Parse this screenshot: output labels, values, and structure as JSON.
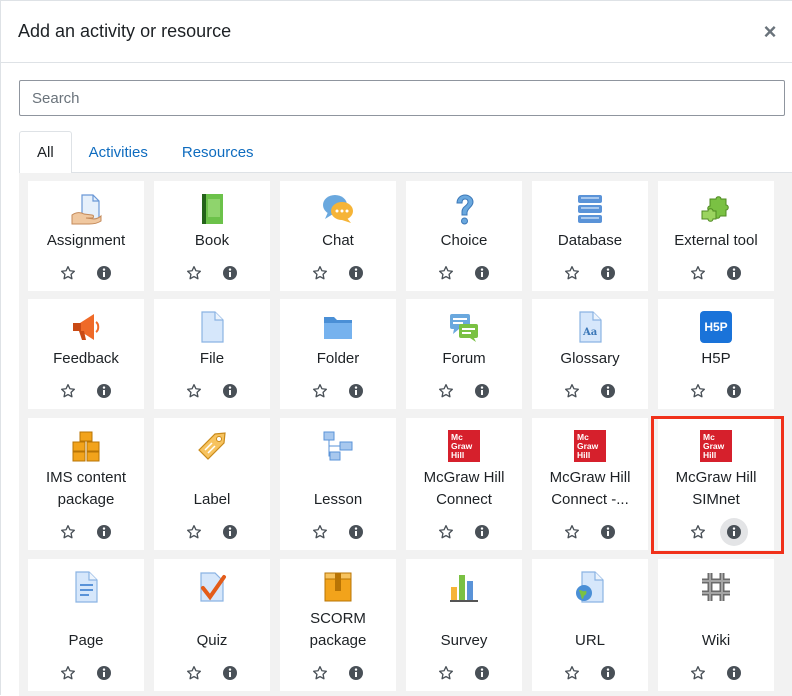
{
  "dialog": {
    "title": "Add an activity or resource",
    "close_glyph": "×",
    "close_icon": "close-icon"
  },
  "search": {
    "placeholder": "Search",
    "value": ""
  },
  "tabs": [
    {
      "label": "All",
      "active": true
    },
    {
      "label": "Activities",
      "active": false
    },
    {
      "label": "Resources",
      "active": false
    }
  ],
  "colors": {
    "link": "#0f6cbf",
    "grid_bg": "#f2f2f2",
    "highlight": "#f0311a",
    "mcgraw_red": "#d6202c"
  },
  "items": [
    {
      "name": "Assignment",
      "icon": "assignment-icon"
    },
    {
      "name": "Book",
      "icon": "book-icon"
    },
    {
      "name": "Chat",
      "icon": "chat-icon"
    },
    {
      "name": "Choice",
      "icon": "choice-icon"
    },
    {
      "name": "Database",
      "icon": "database-icon"
    },
    {
      "name": "External tool",
      "icon": "external-tool-icon"
    },
    {
      "name": "Feedback",
      "icon": "feedback-icon"
    },
    {
      "name": "File",
      "icon": "file-icon"
    },
    {
      "name": "Folder",
      "icon": "folder-icon"
    },
    {
      "name": "Forum",
      "icon": "forum-icon"
    },
    {
      "name": "Glossary",
      "icon": "glossary-icon"
    },
    {
      "name": "H5P",
      "icon": "h5p-icon",
      "logo_text": "H5P"
    },
    {
      "name": "IMS content package",
      "lines": [
        "IMS content",
        "package"
      ],
      "icon": "ims-package-icon"
    },
    {
      "name": "Label",
      "icon": "label-icon"
    },
    {
      "name": "Lesson",
      "icon": "lesson-icon"
    },
    {
      "name": "McGraw Hill Connect",
      "lines": [
        "McGraw Hill",
        "Connect"
      ],
      "icon": "mcgraw-hill-icon",
      "logo_lines": [
        "Mc",
        "Graw",
        "Hill"
      ]
    },
    {
      "name": "McGraw Hill Connect -...",
      "lines": [
        "McGraw Hill",
        "Connect -..."
      ],
      "icon": "mcgraw-hill-icon",
      "logo_lines": [
        "Mc",
        "Graw",
        "Hill"
      ]
    },
    {
      "name": "McGraw Hill SIMnet",
      "lines": [
        "McGraw Hill",
        "SIMnet"
      ],
      "icon": "mcgraw-hill-icon",
      "logo_lines": [
        "Mc",
        "Graw",
        "Hill"
      ],
      "highlighted": true
    },
    {
      "name": "Page",
      "icon": "page-icon"
    },
    {
      "name": "Quiz",
      "icon": "quiz-icon"
    },
    {
      "name": "SCORM package",
      "lines": [
        "SCORM",
        "package"
      ],
      "icon": "scorm-icon"
    },
    {
      "name": "Survey",
      "icon": "survey-icon"
    },
    {
      "name": "URL",
      "icon": "url-icon"
    },
    {
      "name": "Wiki",
      "icon": "wiki-icon"
    }
  ],
  "card_actions": {
    "star_icon": "star-icon",
    "info_icon": "info-icon"
  }
}
